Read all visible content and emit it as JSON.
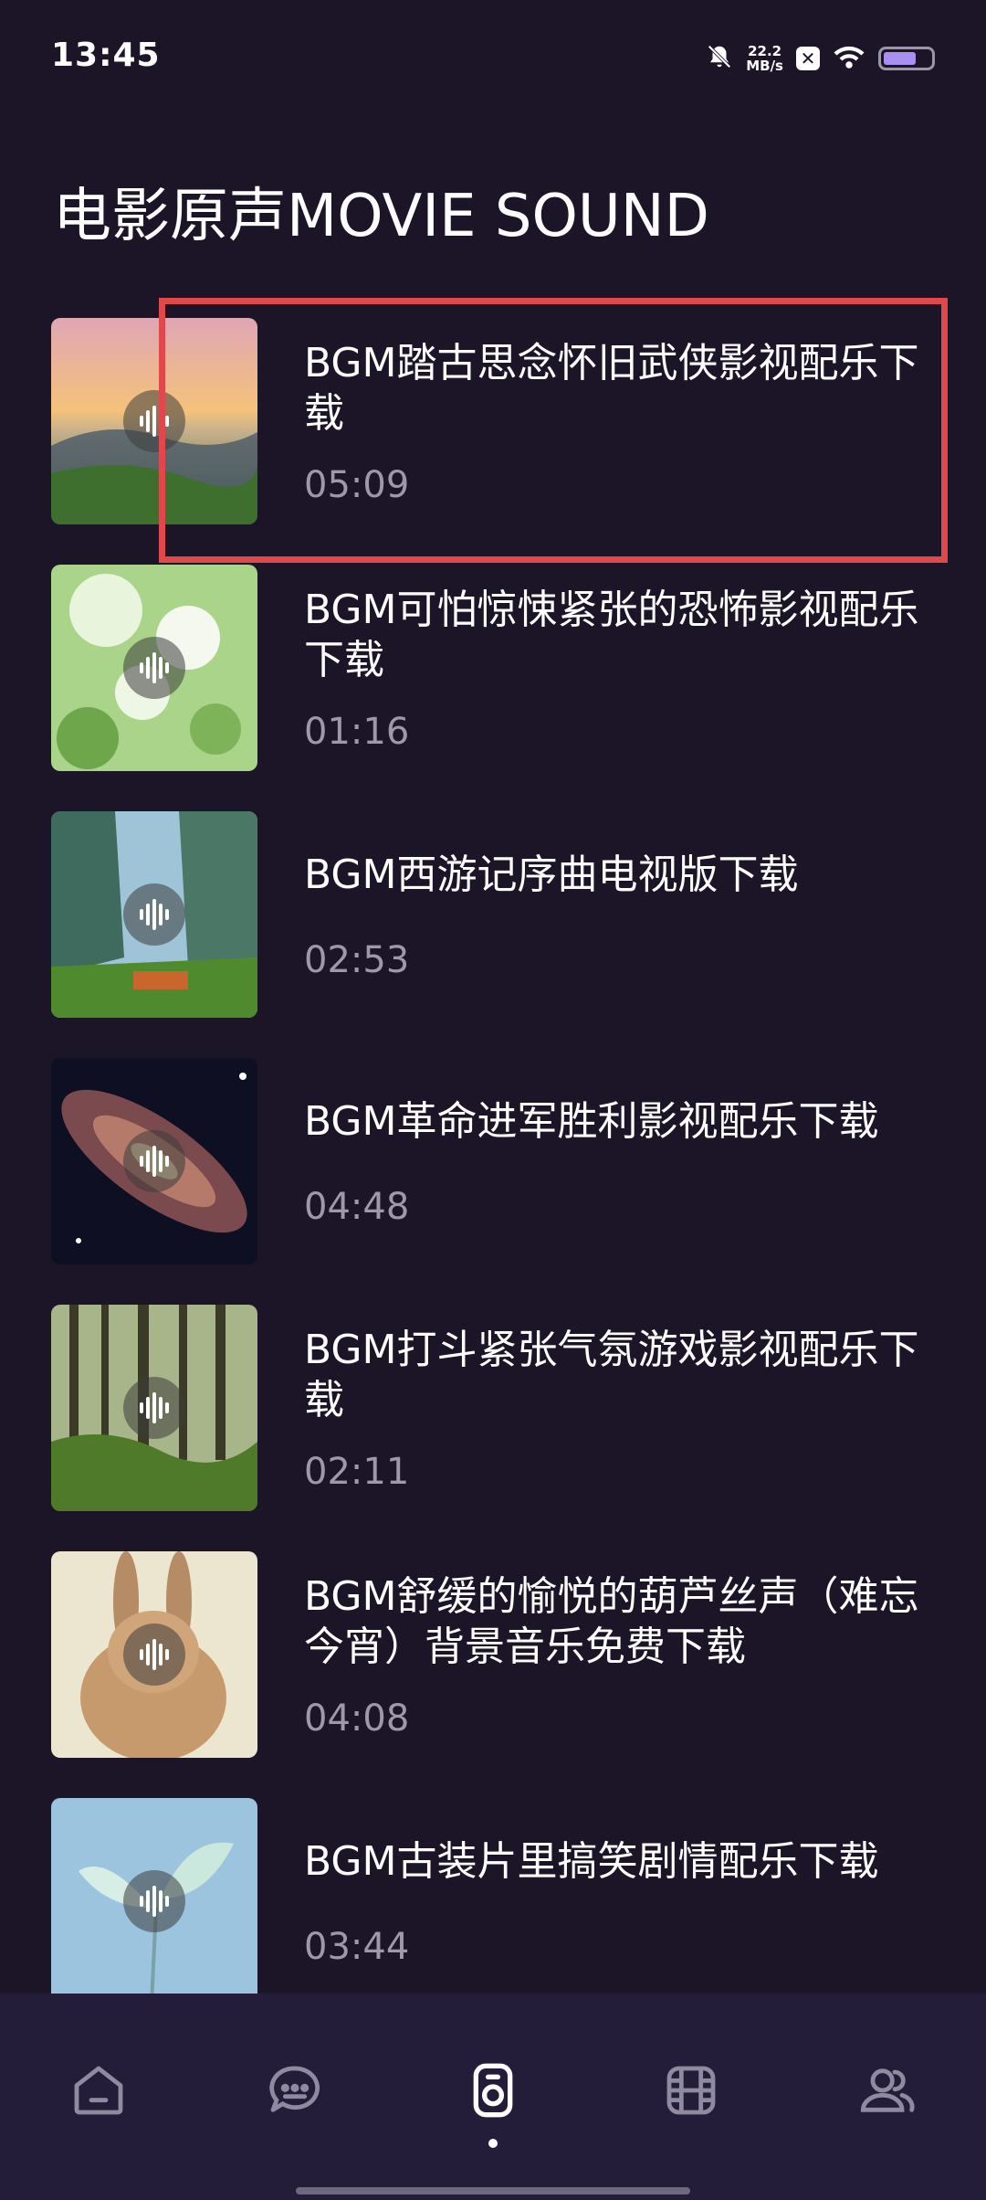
{
  "status": {
    "time": "13:45",
    "speed_value": "22.2",
    "speed_unit": "MB/s",
    "battery_level": 0.7
  },
  "page": {
    "title": "电影原声MOVIE SOUND"
  },
  "items": [
    {
      "title": "BGM踏古思念怀旧武侠影视配乐下载",
      "duration": "05:09",
      "thumb": "sunset-mountains"
    },
    {
      "title": "BGM可怕惊悚紧张的恐怖影视配乐下载",
      "duration": "01:16",
      "thumb": "white-flowers"
    },
    {
      "title": "BGM西游记序曲电视版下载",
      "duration": "02:53",
      "thumb": "canyon-cliffs"
    },
    {
      "title": "BGM革命进军胜利影视配乐下载",
      "duration": "04:48",
      "thumb": "galaxy"
    },
    {
      "title": "BGM打斗紧张气氛游戏影视配乐下载",
      "duration": "02:11",
      "thumb": "forest"
    },
    {
      "title": "BGM舒缓的愉悦的葫芦丝声（难忘今宵）背景音乐免费下载",
      "duration": "04:08",
      "thumb": "rabbit"
    },
    {
      "title": "BGM古装片里搞笑剧情配乐下载",
      "duration": "03:44",
      "thumb": "sprout"
    }
  ],
  "nav": [
    {
      "icon": "home-icon"
    },
    {
      "icon": "chat-icon"
    },
    {
      "icon": "speaker-icon",
      "active": true
    },
    {
      "icon": "film-icon"
    },
    {
      "icon": "users-icon"
    }
  ],
  "colors": {
    "background": "#1c1528",
    "nav_background": "#231d3a",
    "highlight": "#e0484c",
    "secondary_text": "#9e99aa"
  }
}
